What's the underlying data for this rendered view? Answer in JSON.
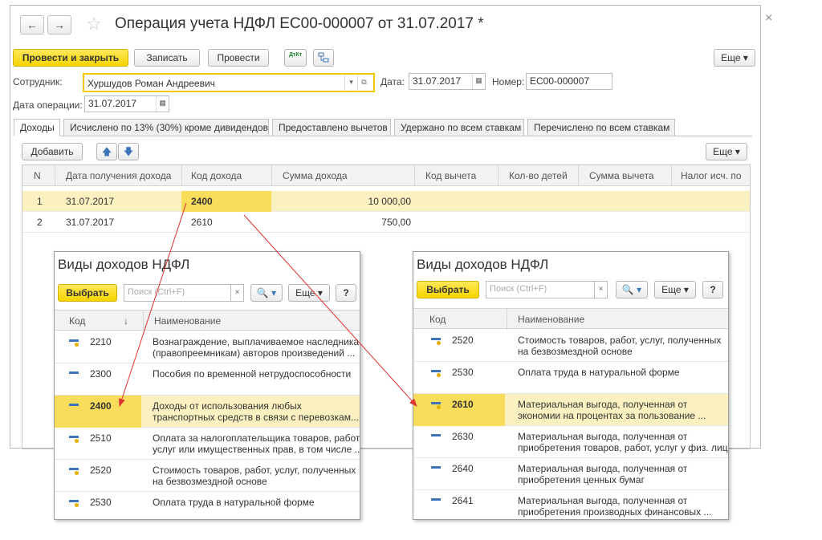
{
  "window": {
    "title": "Операция учета НДФЛ ЕС00-000007 от 31.07.2017 *",
    "close": "×",
    "back": "←",
    "forward": "→",
    "star": "☆"
  },
  "toolbar": {
    "post_close": "Провести и закрыть",
    "save": "Записать",
    "post": "Провести",
    "dtkt": "ДтКт",
    "more": "Еще ▾"
  },
  "form": {
    "employee_label": "Сотрудник:",
    "employee_value": "Хуршудов Роман Андреевич",
    "date_label": "Дата:",
    "date_value": "31.07.2017",
    "number_label": "Номер:",
    "number_value": "ЕС00-000007",
    "op_date_label": "Дата операции:",
    "op_date_value": "31.07.2017"
  },
  "tabs": [
    {
      "label": "Доходы"
    },
    {
      "label": "Исчислено по 13% (30%) кроме дивидендов"
    },
    {
      "label": "Предоставлено вычетов"
    },
    {
      "label": "Удержано по всем ставкам"
    },
    {
      "label": "Перечислено по всем ставкам"
    }
  ],
  "table_toolbar": {
    "add": "Добавить",
    "up": "🡅",
    "down": "🡇",
    "more": "Еще ▾"
  },
  "table": {
    "columns": [
      "N",
      "Дата получения дохода",
      "Код дохода",
      "Сумма дохода",
      "Код вычета",
      "Кол-во детей",
      "Сумма вычета",
      "Налог исч. по"
    ],
    "rows": [
      {
        "n": "1",
        "date": "31.07.2017",
        "code": "2400",
        "sum": "10 000,00"
      },
      {
        "n": "2",
        "date": "31.07.2017",
        "code": "2610",
        "sum": "750,00"
      }
    ]
  },
  "popup_left": {
    "title": "Виды доходов НДФЛ",
    "select": "Выбрать",
    "search_placeholder": "Поиск (Ctrl+F)",
    "clear": "×",
    "search_btn": "🔍 ▾",
    "more": "Еще ▾",
    "help": "?",
    "col_code": "Код",
    "sort": "↓",
    "col_name": "Наименование",
    "rows": [
      {
        "code": "2210",
        "name1": "Вознаграждение, выплачиваемое наследникам",
        "name2": "(правопреемникам) авторов произведений ..."
      },
      {
        "code": "2300",
        "name1": "Пособия по временной нетрудоспособности",
        "name2": ""
      },
      {
        "code": "2400",
        "name1": "Доходы от использования любых",
        "name2": "транспортных средств в связи с перевозкам..."
      },
      {
        "code": "2510",
        "name1": "Оплата за налогоплательщика товаров, работ,",
        "name2": "услуг или имущественных прав, в том числе ..."
      },
      {
        "code": "2520",
        "name1": "Стоимость товаров, работ, услуг, полученных",
        "name2": "на безвозмездной основе"
      },
      {
        "code": "2530",
        "name1": "Оплата труда в натуральной форме",
        "name2": ""
      }
    ]
  },
  "popup_right": {
    "title": "Виды доходов НДФЛ",
    "select": "Выбрать",
    "search_placeholder": "Поиск (Ctrl+F)",
    "clear": "×",
    "search_btn": "🔍 ▾",
    "more": "Еще ▾",
    "help": "?",
    "col_code": "Код",
    "col_name": "Наименование",
    "rows": [
      {
        "code": "2520",
        "name1": "Стоимость товаров, работ, услуг, полученных",
        "name2": "на безвозмездной основе"
      },
      {
        "code": "2530",
        "name1": "Оплата труда в натуральной форме",
        "name2": ""
      },
      {
        "code": "2610",
        "name1": "Материальная выгода, полученная от",
        "name2": "экономии на процентах за пользование ..."
      },
      {
        "code": "2630",
        "name1": "Материальная выгода, полученная от",
        "name2": "приобретения товаров, работ, услуг у физ. лиц"
      },
      {
        "code": "2640",
        "name1": "Материальная выгода, полученная от",
        "name2": "приобретения ценных бумаг"
      },
      {
        "code": "2641",
        "name1": "Материальная выгода, полученная от",
        "name2": "приобретения производных финансовых ..."
      }
    ]
  },
  "colors": {
    "accent": "#f5d400",
    "selection": "#fbf1c0",
    "arrow": "#e03030"
  }
}
